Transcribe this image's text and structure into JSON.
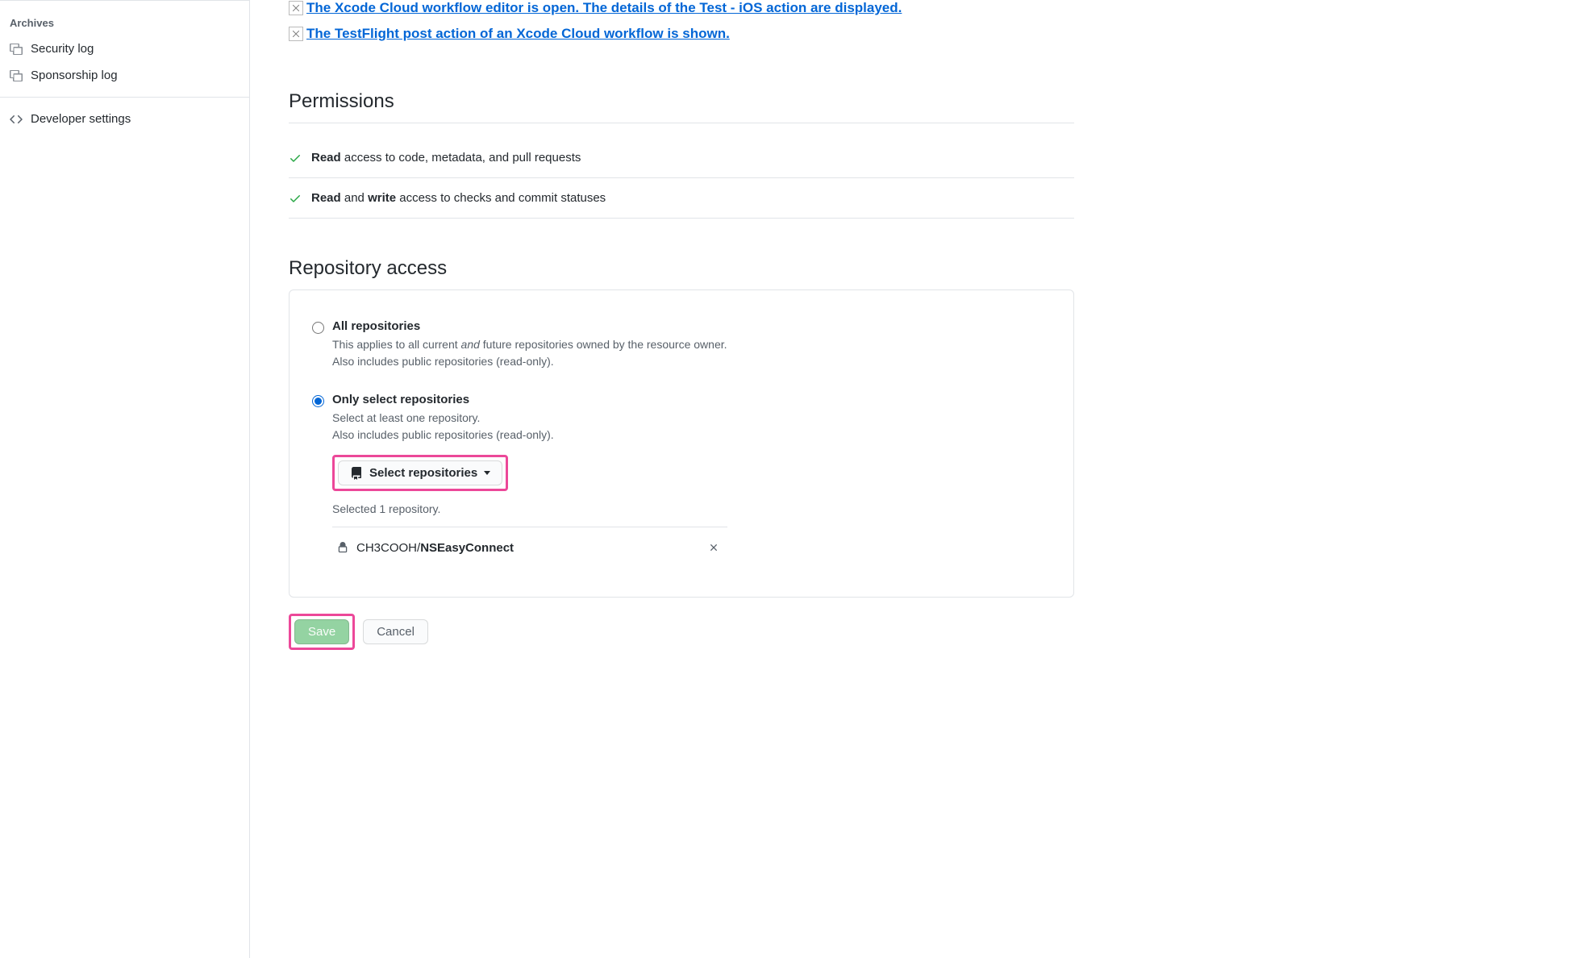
{
  "sidebar": {
    "section_title": "Archives",
    "items": [
      {
        "label": "Security log"
      },
      {
        "label": "Sponsorship log"
      }
    ],
    "developer_settings": "Developer settings"
  },
  "top_links": [
    "The Xcode Cloud workflow editor is open. The details of the Test - iOS action are displayed.",
    "The TestFlight post action of an Xcode Cloud workflow is shown."
  ],
  "permissions": {
    "heading": "Permissions",
    "rows": [
      {
        "bold1": "Read",
        "rest1": " access to code, metadata, and pull requests",
        "bold2": "",
        "rest2": ""
      },
      {
        "bold1": "Read",
        "rest1": " and ",
        "bold2": "write",
        "rest2": " access to checks and commit statuses"
      }
    ]
  },
  "repo_access": {
    "heading": "Repository access",
    "option_all": {
      "label": "All repositories",
      "desc_pre": "This applies to all current ",
      "desc_em": "and",
      "desc_post": " future repositories owned by the resource owner.",
      "desc_line2": "Also includes public repositories (read-only)."
    },
    "option_select": {
      "label": "Only select repositories",
      "desc_line1": "Select at least one repository.",
      "desc_line2": "Also includes public repositories (read-only).",
      "button_label": "Select repositories",
      "selected_text": "Selected 1 repository."
    },
    "selected_repo": {
      "owner": "CH3COOH/",
      "name": "NSEasyConnect"
    }
  },
  "actions": {
    "save": "Save",
    "cancel": "Cancel"
  }
}
